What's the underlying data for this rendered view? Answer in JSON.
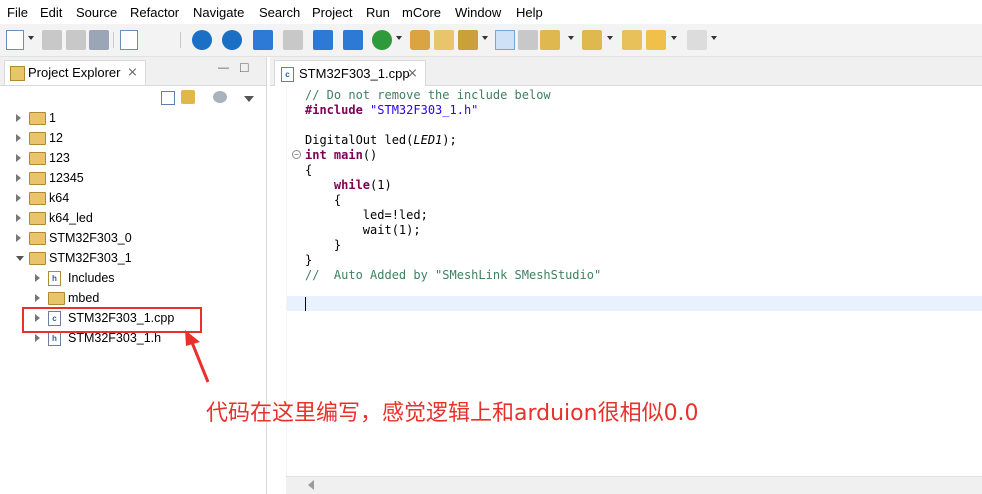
{
  "menubar": {
    "items": [
      "File",
      "Edit",
      "Source",
      "Refactor",
      "Navigate",
      "Search",
      "Project",
      "Run",
      "mCore",
      "Window",
      "Help"
    ]
  },
  "explorer": {
    "title": "Project Explorer",
    "close_glyph": "⨯",
    "minimize_glyph": "—",
    "maximize_glyph": "□",
    "tree": [
      {
        "label": "1",
        "type": "folder",
        "expanded": false,
        "level": 0
      },
      {
        "label": "12",
        "type": "folder",
        "expanded": false,
        "level": 0
      },
      {
        "label": "123",
        "type": "folder",
        "expanded": false,
        "level": 0
      },
      {
        "label": "12345",
        "type": "folder",
        "expanded": false,
        "level": 0
      },
      {
        "label": "k64",
        "type": "folder",
        "expanded": false,
        "level": 0
      },
      {
        "label": "k64_led",
        "type": "folder",
        "expanded": false,
        "level": 0
      },
      {
        "label": "STM32F303_0",
        "type": "folder",
        "expanded": false,
        "level": 0
      },
      {
        "label": "STM32F303_1",
        "type": "folder",
        "expanded": true,
        "level": 0
      },
      {
        "label": "Includes",
        "type": "includes",
        "expanded": false,
        "level": 1
      },
      {
        "label": "mbed",
        "type": "folder",
        "expanded": false,
        "level": 1
      },
      {
        "label": "STM32F303_1.cpp",
        "type": "cpp",
        "expanded": false,
        "level": 1
      },
      {
        "label": "STM32F303_1.h",
        "type": "h",
        "expanded": false,
        "level": 1
      }
    ]
  },
  "editor": {
    "tab_label": "STM32F303_1.cpp",
    "tab_close": "⨯",
    "lines": [
      {
        "cls": "cm",
        "text": "// Do not remove the include below"
      },
      {
        "parts": [
          {
            "cls": "kw",
            "text": "#include "
          },
          {
            "cls": "str",
            "text": "\"STM32F303_1.h\""
          }
        ]
      },
      {
        "text": ""
      },
      {
        "parts": [
          {
            "text": "DigitalOut led("
          },
          {
            "cls": "it",
            "text": "LED1"
          },
          {
            "text": ");"
          }
        ]
      },
      {
        "parts": [
          {
            "cls": "kw",
            "text": "int "
          },
          {
            "cls": "kw",
            "text": "main"
          },
          {
            "text": "()"
          }
        ]
      },
      {
        "text": "{"
      },
      {
        "parts": [
          {
            "text": "    "
          },
          {
            "cls": "kw",
            "text": "while"
          },
          {
            "text": "(1)"
          }
        ]
      },
      {
        "text": "    {"
      },
      {
        "text": "        led=!led;"
      },
      {
        "text": "        wait(1);"
      },
      {
        "text": "    }"
      },
      {
        "text": "}"
      },
      {
        "cls": "cm",
        "text": "//  Auto Added by \"SMeshLink SMeshStudio\""
      }
    ]
  },
  "annotation": {
    "note": "代码在这里编写，感觉逻辑上和arduion很相似0.0",
    "color": "#e8312a"
  },
  "colors": {
    "accent": "#1b6fc5",
    "comment": "#3f7f5f",
    "keyword": "#7f0055",
    "string": "#2a00ff",
    "current_line": "#e8f2fe"
  }
}
